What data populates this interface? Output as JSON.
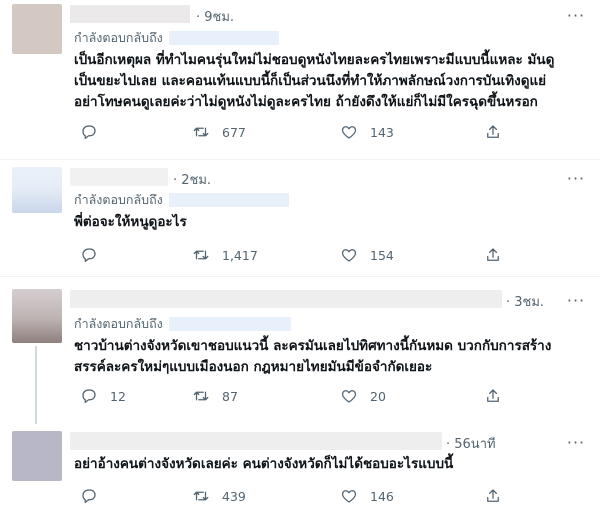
{
  "tweets": [
    {
      "time": "9ชม.",
      "reply_prefix": "กำลังตอบกลับถึง",
      "text_lines": [
        "เป็นอีกเหตุผล ที่ทำไมคนรุ่นใหม่ไม่ชอบดูหนังไทยละครไทยเพราะมีแบบนี้แหละ มันดู",
        "เป็นขยะไปเลย และคอนเท้นแบบนี้ก็เป็นส่วนนึงที่ทำให้ภาพลักษณ์วงการบันเทิงดูแย่",
        "อย่าโทษคนดูเลยค่ะว่าไม่ดูหนังไม่ดูละครไทย ถ้ายังดึงให้แย่ก็ไม่มีใครฉุดขึ้นหรอก"
      ],
      "replies": "",
      "retweets": "677",
      "likes": "143"
    },
    {
      "time": "2ชม.",
      "reply_prefix": "กำลังตอบกลับถึง",
      "text_lines": [
        "พี่ต่อจะให้หนูดูอะไร"
      ],
      "replies": "",
      "retweets": "1,417",
      "likes": "154"
    },
    {
      "time": "3ชม.",
      "reply_prefix": "กำลังตอบกลับถึง",
      "text_lines": [
        "ชาวบ้านต่างจังหวัดเขาชอบแนวนี้ ละครมันเลยไปทิศทางนี้กันหมด บวกกับการสร้าง",
        "สรรค์ละครใหม่ๆแบบเมืองนอก กฎหมายไทยมันมีข้อจำกัดเยอะ"
      ],
      "replies": "12",
      "retweets": "87",
      "likes": "20"
    },
    {
      "time": "56นาที",
      "reply_prefix": "",
      "text_lines": [
        "อย่าอ้างคนต่างจังหวัดเลยค่ะ คนต่างจังหวัดก็ไม่ได้ชอบอะไรแบบนี้"
      ],
      "replies": "",
      "retweets": "439",
      "likes": "146"
    }
  ],
  "icons": {
    "reply": "reply-icon",
    "retweet": "retweet-icon",
    "like": "heart-icon",
    "share": "share-icon",
    "more": "more-icon"
  },
  "colors": {
    "secondary_text": "#536471",
    "reply_link_bg": "#e8f1fb",
    "divider": "#eff3f4"
  }
}
